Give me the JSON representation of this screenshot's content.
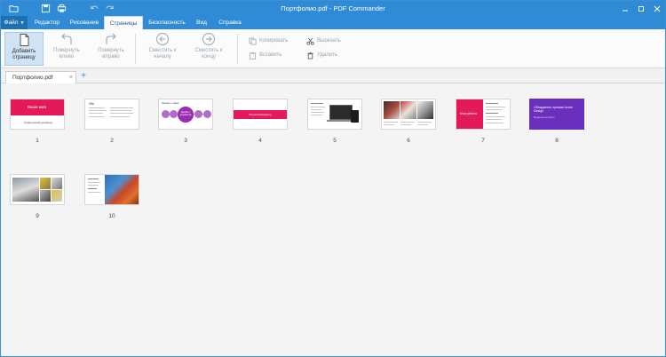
{
  "window": {
    "title": "Портфолио.pdf - PDF Commander"
  },
  "quick_access": [
    "open-folder-icon",
    "save-icon",
    "print-icon",
    "undo-icon",
    "redo-icon"
  ],
  "tabs": {
    "file": "Файл",
    "items": [
      "Редактор",
      "Рисование",
      "Страницы",
      "Безопасность",
      "Вид",
      "Справка"
    ],
    "active": "Страницы"
  },
  "ribbon": {
    "add_page": [
      "Добавить",
      "страницу"
    ],
    "rotate_left": [
      "Повернуть",
      "влево"
    ],
    "rotate_right": [
      "Повернуть",
      "вправо"
    ],
    "move_start": [
      "Сместить к",
      "началу"
    ],
    "move_end": [
      "Сместить к",
      "концу"
    ],
    "copy": "Копировать",
    "paste": "Вставить",
    "cut": "Вырезать",
    "delete": "Удалить"
  },
  "document_tab": {
    "name": "Портфолио.pdf",
    "close": "×",
    "add": "+"
  },
  "pages": [
    {
      "number": "1",
      "title": "Ваше имя",
      "subtitle": "Графический дизайнер"
    },
    {
      "number": "2",
      "title": "Обо"
    },
    {
      "number": "3",
      "title": "Начало с нами",
      "center": "Дизайн и разработка"
    },
    {
      "number": "4",
      "title": "Physical Designing"
    },
    {
      "number": "5"
    },
    {
      "number": "6"
    },
    {
      "number": "7",
      "title": "Мои работы"
    },
    {
      "number": "8",
      "title": "Обладатель премии Acme Design",
      "subtitle": "Выдающиеся работы"
    },
    {
      "number": "9"
    },
    {
      "number": "10"
    }
  ],
  "colors": {
    "accent": "#2f8bd5",
    "pink": "#e3195a",
    "purple": "#6a2fbd",
    "violet": "#9b2bb0"
  }
}
